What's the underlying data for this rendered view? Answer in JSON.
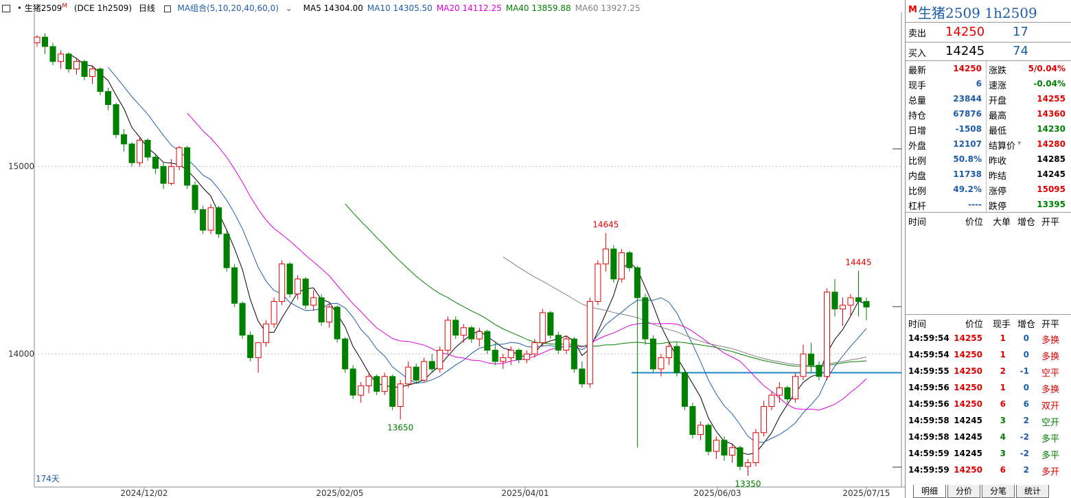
{
  "header": {
    "symbol": "生猪2509",
    "symbol_mark": "M",
    "code": "(DCE 1h2509)",
    "period": "日线",
    "ma_group": "MA组合(5,10,20,40,60,0)",
    "ma_items": [
      {
        "label": "MA5 14304.00",
        "color": "#000000"
      },
      {
        "label": "MA10 14305.50",
        "color": "#1e5ca8"
      },
      {
        "label": "MA20 14112.25",
        "color": "#e000e0"
      },
      {
        "label": "MA40 13859.88",
        "color": "#008000"
      },
      {
        "label": "MA60 13927.25",
        "color": "#808080"
      }
    ]
  },
  "chart_data": {
    "type": "candlestick",
    "y_ticks": [
      "15000",
      "14000"
    ],
    "x_ticks": [
      "2024/12/02",
      "2025/02/05",
      "2025/04/01",
      "2025/06/03",
      "2025/07/15"
    ],
    "bar_count_label": "174天",
    "annotations": [
      {
        "label": "14645",
        "kind": "high",
        "color": "#e00000"
      },
      {
        "label": "13650",
        "kind": "low",
        "color": "#008000"
      },
      {
        "label": "14445",
        "kind": "high",
        "color": "#e00000"
      },
      {
        "label": "13350",
        "kind": "low",
        "color": "#008000"
      }
    ],
    "hline_value": 13900,
    "candles": [
      [
        15660,
        15700,
        15640,
        15690
      ],
      [
        15690,
        15710,
        15600,
        15640
      ],
      [
        15640,
        15660,
        15540,
        15560
      ],
      [
        15560,
        15620,
        15520,
        15600
      ],
      [
        15600,
        15610,
        15500,
        15520
      ],
      [
        15520,
        15580,
        15490,
        15560
      ],
      [
        15560,
        15570,
        15460,
        15480
      ],
      [
        15480,
        15540,
        15440,
        15520
      ],
      [
        15520,
        15530,
        15380,
        15400
      ],
      [
        15400,
        15420,
        15300,
        15330
      ],
      [
        15330,
        15340,
        15150,
        15170
      ],
      [
        15170,
        15200,
        15080,
        15120
      ],
      [
        15120,
        15130,
        15000,
        15020
      ],
      [
        15020,
        15160,
        15000,
        15140
      ],
      [
        15140,
        15150,
        15030,
        15050
      ],
      [
        15050,
        15070,
        14960,
        14990
      ],
      [
        15000,
        15020,
        14880,
        14910
      ],
      [
        14910,
        15040,
        14900,
        15000
      ],
      [
        15000,
        15110,
        14980,
        15100
      ],
      [
        15100,
        15110,
        14880,
        14900
      ],
      [
        14900,
        14920,
        14750,
        14770
      ],
      [
        14770,
        14790,
        14640,
        14660
      ],
      [
        14660,
        14800,
        14640,
        14780
      ],
      [
        14780,
        14790,
        14620,
        14640
      ],
      [
        14640,
        14660,
        14440,
        14460
      ],
      [
        14460,
        14480,
        14250,
        14270
      ],
      [
        14270,
        14280,
        14080,
        14100
      ],
      [
        14100,
        14120,
        13960,
        13980
      ],
      [
        13980,
        14000,
        13900,
        14060
      ],
      [
        14060,
        14180,
        14040,
        14160
      ],
      [
        14160,
        14300,
        14140,
        14280
      ],
      [
        14280,
        14500,
        14260,
        14480
      ],
      [
        14480,
        14490,
        14300,
        14320
      ],
      [
        14320,
        14420,
        14290,
        14400
      ],
      [
        14400,
        14410,
        14240,
        14260
      ],
      [
        14260,
        14340,
        14230,
        14300
      ],
      [
        14300,
        14320,
        14150,
        14170
      ],
      [
        14170,
        14270,
        14140,
        14250
      ],
      [
        14250,
        14260,
        14060,
        14080
      ],
      [
        14080,
        14090,
        13900,
        13920
      ],
      [
        13920,
        13940,
        13760,
        13780
      ],
      [
        13780,
        13850,
        13740,
        13830
      ],
      [
        13830,
        13900,
        13790,
        13880
      ],
      [
        13880,
        13890,
        13780,
        13800
      ],
      [
        13800,
        13900,
        13780,
        13880
      ],
      [
        13880,
        13890,
        13700,
        13720
      ],
      [
        13720,
        13860,
        13650,
        13840
      ],
      [
        13840,
        13960,
        13820,
        13930
      ],
      [
        13930,
        13950,
        13840,
        13860
      ],
      [
        13860,
        13980,
        13850,
        13960
      ],
      [
        13960,
        14000,
        13900,
        13920
      ],
      [
        13920,
        14040,
        13900,
        14020
      ],
      [
        14020,
        14200,
        14000,
        14180
      ],
      [
        14180,
        14200,
        14080,
        14100
      ],
      [
        14100,
        14160,
        14060,
        14140
      ],
      [
        14140,
        14150,
        14060,
        14080
      ],
      [
        14080,
        14140,
        14040,
        14120
      ],
      [
        14120,
        14130,
        14000,
        14020
      ],
      [
        14020,
        14060,
        13940,
        13960
      ],
      [
        13960,
        14000,
        13920,
        13980
      ],
      [
        13980,
        14040,
        13940,
        14020
      ],
      [
        14020,
        14030,
        13950,
        13970
      ],
      [
        13970,
        14020,
        13950,
        14000
      ],
      [
        14000,
        14080,
        13980,
        14060
      ],
      [
        14060,
        14240,
        14040,
        14220
      ],
      [
        14220,
        14230,
        14080,
        14100
      ],
      [
        14100,
        14120,
        14000,
        14020
      ],
      [
        14020,
        14100,
        14000,
        14080
      ],
      [
        14080,
        14090,
        13900,
        13920
      ],
      [
        13920,
        13960,
        13820,
        13840
      ],
      [
        13840,
        14300,
        13820,
        14280
      ],
      [
        14280,
        14500,
        14260,
        14480
      ],
      [
        14480,
        14645,
        14440,
        14560
      ],
      [
        14560,
        14580,
        14380,
        14400
      ],
      [
        14400,
        14560,
        14380,
        14540
      ],
      [
        14540,
        14550,
        14440,
        14460
      ],
      [
        14460,
        14470,
        13500,
        14300
      ],
      [
        14300,
        14320,
        14050,
        14080
      ],
      [
        14080,
        14100,
        13900,
        13920
      ],
      [
        13920,
        14000,
        13880,
        13980
      ],
      [
        13980,
        14060,
        13940,
        14040
      ],
      [
        14040,
        14060,
        13880,
        13900
      ],
      [
        13900,
        13920,
        13700,
        13720
      ],
      [
        13720,
        13740,
        13550,
        13570
      ],
      [
        13570,
        13640,
        13540,
        13620
      ],
      [
        13620,
        13630,
        13460,
        13480
      ],
      [
        13480,
        13560,
        13440,
        13540
      ],
      [
        13540,
        13560,
        13430,
        13460
      ],
      [
        13460,
        13520,
        13420,
        13500
      ],
      [
        13500,
        13510,
        13380,
        13400
      ],
      [
        13400,
        13440,
        13350,
        13420
      ],
      [
        13420,
        13600,
        13400,
        13580
      ],
      [
        13580,
        13750,
        13560,
        13720
      ],
      [
        13720,
        13800,
        13700,
        13780
      ],
      [
        13780,
        13850,
        13740,
        13820
      ],
      [
        13820,
        13830,
        13740,
        13760
      ],
      [
        13760,
        13900,
        13740,
        13880
      ],
      [
        13880,
        14050,
        13860,
        14000
      ],
      [
        14000,
        14060,
        13900,
        13940
      ],
      [
        13940,
        13960,
        13860,
        13880
      ],
      [
        13880,
        14350,
        13860,
        14330
      ],
      [
        14330,
        14400,
        14200,
        14240
      ],
      [
        14240,
        14300,
        14150,
        14260
      ],
      [
        14260,
        14320,
        14200,
        14300
      ],
      [
        14300,
        14445,
        14200,
        14280
      ],
      [
        14280,
        14300,
        14180,
        14250
      ]
    ]
  },
  "panel": {
    "title": "生猪2509  1h2509",
    "title_mark": "M",
    "ask_label": "卖出",
    "ask_price": "14250",
    "ask_vol": "17",
    "bid_label": "买入",
    "bid_price": "14245",
    "bid_vol": "74",
    "left_stats": [
      {
        "label": "最新",
        "value": "14250",
        "color": "#e00000"
      },
      {
        "label": "现手",
        "value": "6",
        "color": "#1e5ca8"
      },
      {
        "label": "总量",
        "value": "23844",
        "color": "#1e5ca8"
      },
      {
        "label": "持仓",
        "value": "67876",
        "color": "#1e5ca8"
      },
      {
        "label": "日增",
        "value": "-1508",
        "color": "#1e5ca8"
      },
      {
        "label": "外盘",
        "value": "12107",
        "color": "#1e5ca8"
      },
      {
        "label": "比例",
        "value": "50.8%",
        "color": "#1e5ca8"
      },
      {
        "label": "内盘",
        "value": "11738",
        "color": "#1e5ca8"
      },
      {
        "label": "比例",
        "value": "49.2%",
        "color": "#1e5ca8"
      },
      {
        "label": "杠杆",
        "value": "----",
        "color": "#1e5ca8"
      }
    ],
    "right_stats": [
      {
        "label": "涨跌",
        "value": "5/0.04%",
        "color": "#e00000"
      },
      {
        "label": "速涨",
        "value": "-0.04%",
        "color": "#008000"
      },
      {
        "label": "开盘",
        "value": "14255",
        "color": "#e00000"
      },
      {
        "label": "最高",
        "value": "14360",
        "color": "#e00000"
      },
      {
        "label": "最低",
        "value": "14230",
        "color": "#008000"
      },
      {
        "label": "结算价",
        "value": "14280",
        "color": "#e00000"
      },
      {
        "label": "昨收",
        "value": "14285",
        "color": "#000000"
      },
      {
        "label": "昨结",
        "value": "14245",
        "color": "#000000"
      },
      {
        "label": "涨停",
        "value": "15095",
        "color": "#e00000"
      },
      {
        "label": "跌停",
        "value": "13395",
        "color": "#008000"
      }
    ],
    "section1_headers": [
      "时间",
      "价位",
      "大单",
      "增仓",
      "开平"
    ],
    "section2_headers": [
      "时间",
      "价位",
      "现手",
      "增仓",
      "开平"
    ],
    "trades": [
      {
        "time": "14:59:54",
        "price": "14255",
        "price_color": "#e00000",
        "vol": "1",
        "vol_color": "#e00000",
        "chg": "0",
        "type": "多换",
        "type_color": "#e00000"
      },
      {
        "time": "14:59:54",
        "price": "14250",
        "price_color": "#e00000",
        "vol": "1",
        "vol_color": "#e00000",
        "chg": "0",
        "type": "多换",
        "type_color": "#e00000"
      },
      {
        "time": "14:59:55",
        "price": "14250",
        "price_color": "#e00000",
        "vol": "2",
        "vol_color": "#e00000",
        "chg": "-1",
        "type": "空平",
        "type_color": "#e00000"
      },
      {
        "time": "14:59:56",
        "price": "14250",
        "price_color": "#e00000",
        "vol": "1",
        "vol_color": "#e00000",
        "chg": "0",
        "type": "多换",
        "type_color": "#e00000"
      },
      {
        "time": "14:59:56",
        "price": "14250",
        "price_color": "#e00000",
        "vol": "6",
        "vol_color": "#e00000",
        "chg": "6",
        "type": "双开",
        "type_color": "#e00000"
      },
      {
        "time": "14:59:58",
        "price": "14245",
        "price_color": "#000000",
        "vol": "3",
        "vol_color": "#008000",
        "chg": "2",
        "type": "空开",
        "type_color": "#008000"
      },
      {
        "time": "14:59:58",
        "price": "14245",
        "price_color": "#000000",
        "vol": "4",
        "vol_color": "#008000",
        "chg": "-2",
        "type": "多平",
        "type_color": "#008000"
      },
      {
        "time": "14:59:59",
        "price": "14245",
        "price_color": "#000000",
        "vol": "3",
        "vol_color": "#008000",
        "chg": "-2",
        "type": "多平",
        "type_color": "#008000"
      },
      {
        "time": "14:59:59",
        "price": "14250",
        "price_color": "#e00000",
        "vol": "6",
        "vol_color": "#e00000",
        "chg": "2",
        "type": "多开",
        "type_color": "#e00000"
      }
    ],
    "tabs": [
      "明细",
      "分价",
      "分笔",
      "统计"
    ]
  }
}
